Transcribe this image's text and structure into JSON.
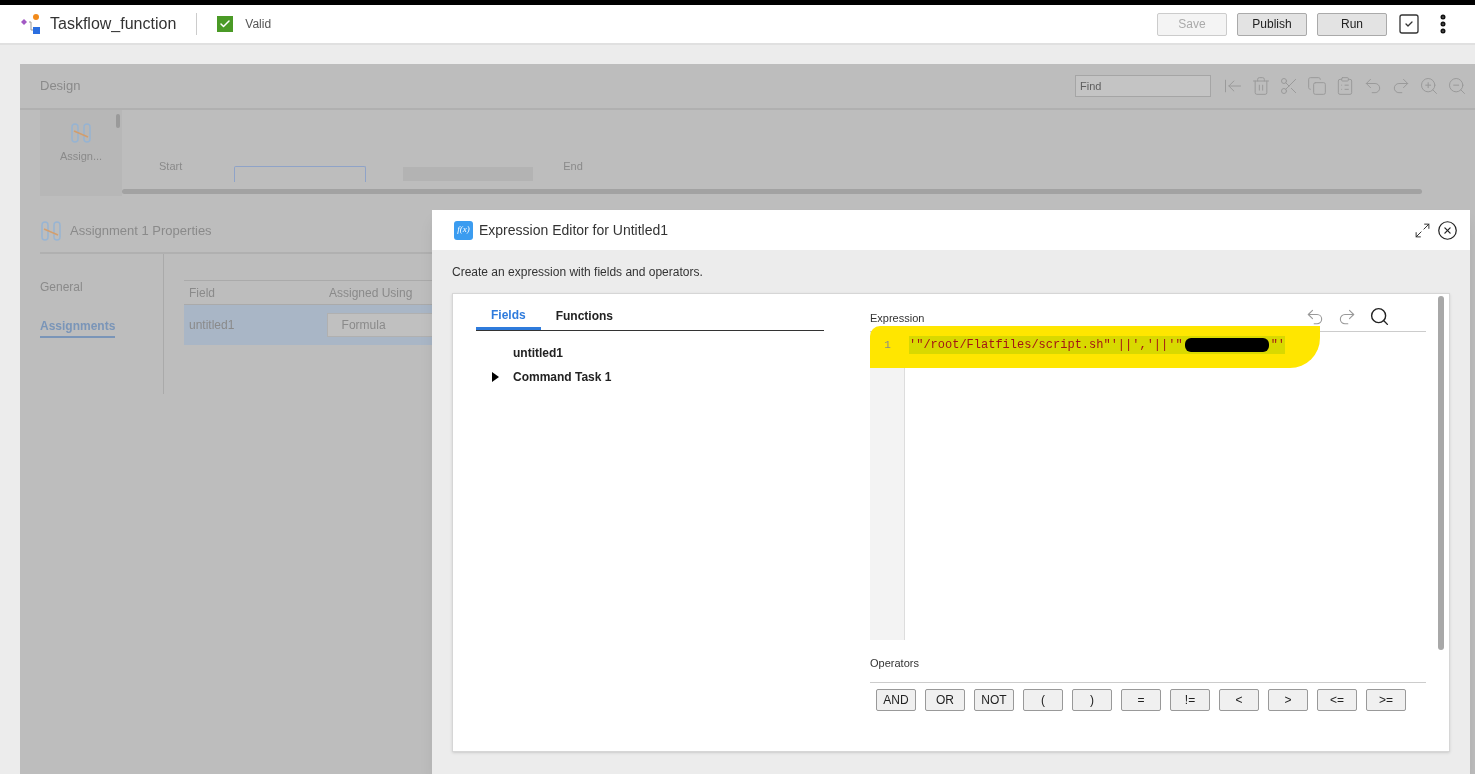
{
  "header": {
    "title": "Taskflow_function",
    "status": "Valid",
    "valid": true,
    "buttons": [
      {
        "label": "Save",
        "disabled": true
      },
      {
        "label": "Publish",
        "disabled": false
      },
      {
        "label": "Run",
        "disabled": false
      }
    ]
  },
  "design": {
    "title": "Design",
    "find_placeholder": "Find",
    "palette": [
      {
        "label": "Assign..."
      }
    ],
    "canvas": {
      "start": "Start",
      "end": "End"
    }
  },
  "properties": {
    "title": "Assignment 1 Properties",
    "tabs": [
      {
        "label": "General",
        "selected": false
      },
      {
        "label": "Assignments",
        "selected": true
      }
    ],
    "columns": [
      "Field",
      "Assigned Using"
    ],
    "rows": [
      {
        "field": "untitled1",
        "assigned_using": "Formula",
        "selected": true
      }
    ]
  },
  "dialog": {
    "icon_text": "f(x)",
    "title": "Expression Editor for Untitled1",
    "description": "Create an expression with fields and operators.",
    "tabs": [
      {
        "label": "Fields",
        "selected": true
      },
      {
        "label": "Functions",
        "selected": false
      }
    ],
    "tree": [
      {
        "label": "untitled1"
      },
      {
        "label": "Command Task 1",
        "expanded": false
      }
    ],
    "expression_label": "Expression",
    "lines": [
      {
        "number": "1",
        "text_before": "'\"/root/Flatfiles/script.sh\"'||','||'\"",
        "redacted": true,
        "text_after": "\"'"
      }
    ],
    "operators_label": "Operators",
    "operators": [
      "AND",
      "OR",
      "NOT",
      "(",
      ")",
      "=",
      "!=",
      "<",
      ">",
      "<=",
      ">="
    ]
  }
}
